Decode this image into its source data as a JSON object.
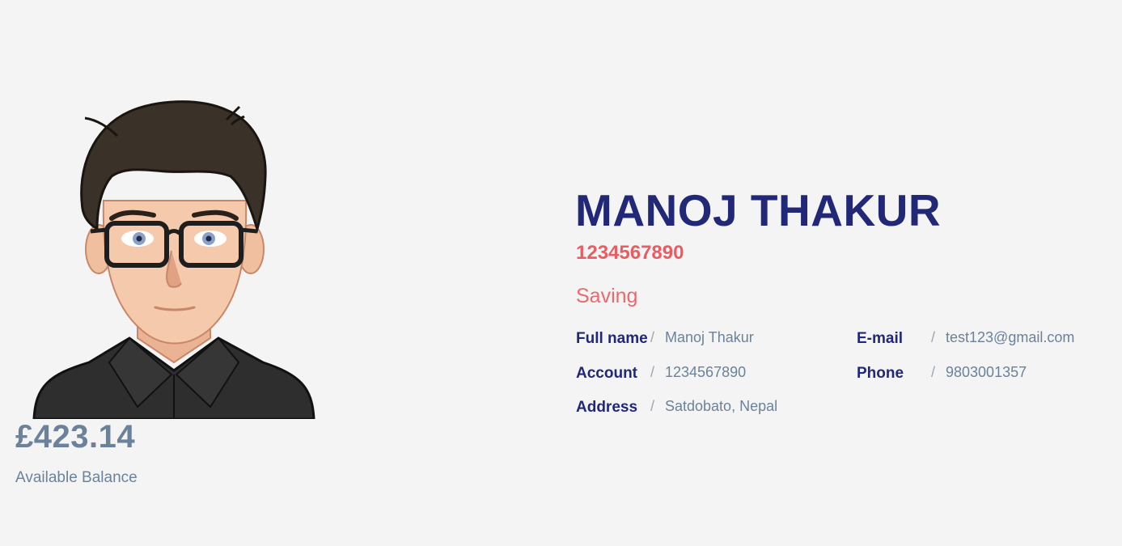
{
  "profile": {
    "name": "MANOJ THAKUR",
    "account_number": "1234567890",
    "account_type": "Saving",
    "avatar_icon": "cartoon-man-avatar"
  },
  "balance": {
    "amount": "£423.14",
    "label": "Available Balance"
  },
  "details": {
    "separator": "/",
    "full_name": {
      "label": "Full name",
      "value": "Manoj Thakur"
    },
    "account": {
      "label": "Account",
      "value": "1234567890"
    },
    "address": {
      "label": "Address",
      "value": "Satdobato, Nepal"
    },
    "email": {
      "label": "E-mail",
      "value": "test123@gmail.com"
    },
    "phone": {
      "label": "Phone",
      "value": "9803001357"
    }
  },
  "colors": {
    "background": "#f4f4f4",
    "name": "#212878",
    "accent": "#e85c62",
    "muted": "#6b829a"
  }
}
